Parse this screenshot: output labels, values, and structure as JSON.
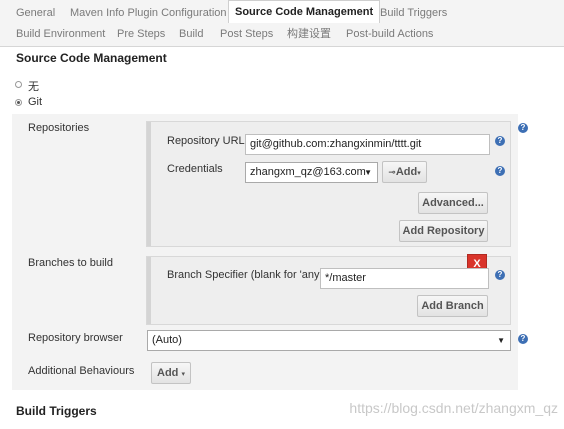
{
  "tabs": {
    "row1": [
      "General",
      "Maven Info Plugin Configuration",
      "Source Code Management",
      "Build Triggers"
    ],
    "row2": [
      "Build Environment",
      "Pre Steps",
      "Build",
      "Post Steps",
      "构建设置",
      "Post-build Actions"
    ],
    "active": "Source Code Management"
  },
  "scm": {
    "title": "Source Code Management",
    "options": [
      "无",
      "Git"
    ],
    "selected": "Git"
  },
  "repositories": {
    "label": "Repositories",
    "url_label": "Repository URL",
    "url_value": "git@github.com:zhangxinmin/tttt.git",
    "credentials_label": "Credentials",
    "credentials_value": "zhangxm_qz@163.com",
    "add_label": "Add",
    "advanced_label": "Advanced...",
    "add_repository_label": "Add Repository"
  },
  "branches": {
    "label": "Branches to build",
    "specifier_label": "Branch Specifier (blank for 'any')",
    "specifier_value": "*/master",
    "delete_label": "X",
    "add_branch_label": "Add Branch"
  },
  "repo_browser": {
    "label": "Repository browser",
    "value": "(Auto)"
  },
  "additional": {
    "label": "Additional Behaviours",
    "add_label": "Add"
  },
  "build_triggers": {
    "title": "Build Triggers"
  },
  "watermark": "https://blog.csdn.net/zhangxm_qz",
  "colors": {
    "help": "#3d6fb4",
    "delete": "#d9342b",
    "panel": "#f3f3f3"
  }
}
